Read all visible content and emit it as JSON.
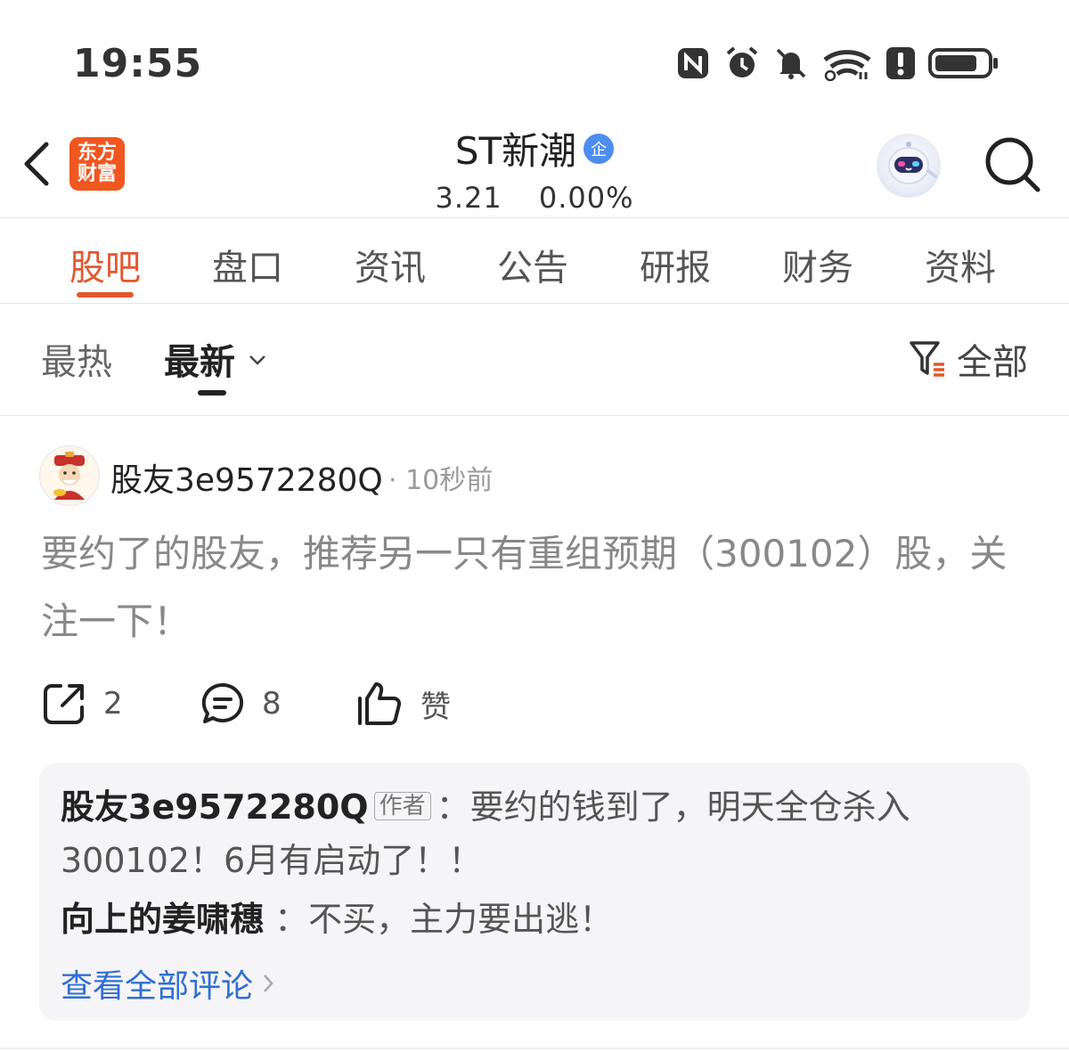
{
  "status_bar": {
    "time": "19:55",
    "icons": [
      "nfc-icon",
      "alarm-icon",
      "mute-icon",
      "wifi-icon",
      "alert-icon",
      "battery-icon"
    ]
  },
  "header": {
    "logo_text_line1": "东方",
    "logo_text_line2": "财富",
    "stock_name": "ST新潮",
    "badge": "企",
    "price": "3.21",
    "change": "0.00%"
  },
  "tabs": [
    {
      "label": "股吧",
      "active": true
    },
    {
      "label": "盘口",
      "active": false
    },
    {
      "label": "资讯",
      "active": false
    },
    {
      "label": "公告",
      "active": false
    },
    {
      "label": "研报",
      "active": false
    },
    {
      "label": "财务",
      "active": false
    },
    {
      "label": "资料",
      "active": false
    }
  ],
  "sort": {
    "hot": "最热",
    "new": "最新",
    "filter": "全部"
  },
  "post": {
    "user": "股友3e9572280Q",
    "time": "· 10秒前",
    "content": "要约了的股友，推荐另一只有重组预期（300102）股，关注一下！",
    "share_count": "2",
    "comment_count": "8",
    "like_label": "赞"
  },
  "comments": {
    "c1_name": "股友3e9572280Q",
    "c1_tag": "作者",
    "c1_text": "：要约的钱到了，明天全仓杀入300102！6月有启动了！！",
    "c2_name": "向上的姜啸穗",
    "c2_text": "：不买，主力要出逃！",
    "view_all": "查看全部评论"
  },
  "colors": {
    "accent": "#e4572e",
    "logo": "#f1561f",
    "link": "#2f6fd1",
    "badge": "#4e8df0"
  }
}
